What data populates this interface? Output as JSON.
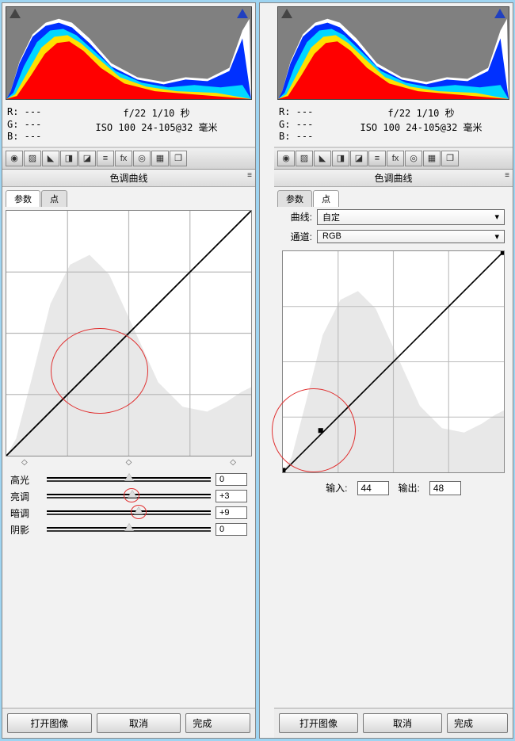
{
  "panel_left": {
    "rgb": {
      "r": "R:  ---",
      "g": "G:  ---",
      "b": "B:  ---"
    },
    "exposure": {
      "line1": "f/22   1/10 秒",
      "line2": "ISO 100   24-105@32 毫米"
    },
    "section_title": "色调曲线",
    "tabs": {
      "params": "参数",
      "points": "点"
    },
    "active_tab": "params",
    "sliders": {
      "highlight": {
        "label": "高光",
        "value": "0",
        "pos": 50
      },
      "light": {
        "label": "亮调",
        "value": "+3",
        "pos": 52
      },
      "dark": {
        "label": "暗调",
        "value": "+9",
        "pos": 56
      },
      "shadow": {
        "label": "阴影",
        "value": "0",
        "pos": 50
      }
    },
    "buttons": {
      "open": "打开图像",
      "cancel": "取消",
      "done": "完成"
    }
  },
  "panel_right": {
    "rgb": {
      "r": "R:  ---",
      "g": "G:  ---",
      "b": "B:  ---"
    },
    "exposure": {
      "line1": "f/22   1/10 秒",
      "line2": "ISO 100   24-105@32 毫米"
    },
    "section_title": "色调曲线",
    "tabs": {
      "params": "参数",
      "points": "点"
    },
    "active_tab": "points",
    "curve_dropdown": {
      "label": "曲线:",
      "value": "自定"
    },
    "channel_dropdown": {
      "label": "通道:",
      "value": "RGB"
    },
    "io": {
      "in_label": "输入:",
      "in_value": "44",
      "out_label": "输出:",
      "out_value": "48"
    },
    "buttons": {
      "open": "打开图像",
      "cancel": "取消",
      "done": "完成"
    }
  },
  "toolbar_icons": [
    "◉",
    "▨",
    "◣",
    "◨",
    "◪",
    "≡",
    "fx",
    "◎",
    "▦",
    "❐"
  ]
}
